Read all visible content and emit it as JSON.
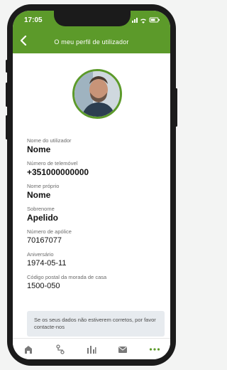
{
  "status_bar": {
    "time": "17:05",
    "icons": "wifi battery"
  },
  "header": {
    "title": "O meu perfil de utilizador"
  },
  "fields": [
    {
      "label": "Nome do utilizador",
      "value": "Nome"
    },
    {
      "label": "Número de telemóvel",
      "value": "+351000000000"
    },
    {
      "label": "Nome próprio",
      "value": "Nome"
    },
    {
      "label": "Sobrenome",
      "value": "Apelido"
    },
    {
      "label": "Número de apólice",
      "value": "70167077"
    },
    {
      "label": "Aniversário",
      "value": "1974-05-11"
    },
    {
      "label": "Código postal da morada de casa",
      "value": "1500-050"
    }
  ],
  "notice": {
    "text": "Se os seus dados não estiverem corretos, por favor contacte-nos"
  },
  "tabbar": {
    "items": [
      "home-icon",
      "route-icon",
      "stats-icon",
      "mail-icon",
      "more-icon"
    ],
    "active_index": 4
  },
  "colors": {
    "accent": "#5c9a2a"
  }
}
